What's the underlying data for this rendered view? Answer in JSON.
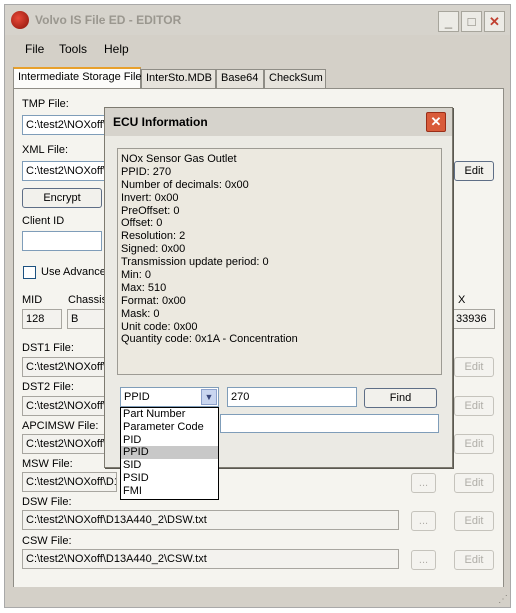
{
  "window": {
    "title": "Volvo IS File ED - EDITOR",
    "minimize_glyph": "_",
    "maximize_glyph": "□",
    "close_glyph": "✕"
  },
  "menu": [
    "File",
    "Tools",
    "Help"
  ],
  "tabs": [
    "Intermediate Storage File",
    "InterSto.MDB",
    "Base64",
    "CheckSum"
  ],
  "form": {
    "tmp_label": "TMP File:",
    "tmp_value": "C:\\test2\\NOXoff\\",
    "xml_label": "XML File:",
    "xml_value": "C:\\test2\\NOXoff\\",
    "xml_edit": "Edit",
    "encrypt_button": "Encrypt",
    "client_id_label": "Client ID",
    "client_id_value": "",
    "use_advanced_label": "Use Advance",
    "mid_label": "MID",
    "mid_value": "128",
    "chassis_label": "Chassis",
    "chassis_value": "B",
    "x_label": "X",
    "x_value": "33936",
    "dst1_label": "DST1 File:",
    "dst1_value": "C:\\test2\\NOXoff\\",
    "dst2_label": "DST2 File:",
    "dst2_value": "C:\\test2\\NOXoff\\",
    "apcimsw_label": "APCIMSW File:",
    "apcimsw_value": "C:\\test2\\NOXoff\\",
    "msw_label": "MSW File:",
    "msw_value": "C:\\test2\\NOXoff\\D13",
    "dsw_label": "DSW File:",
    "dsw_value": "C:\\test2\\NOXoff\\D13A440_2\\DSW.txt",
    "csw_label": "CSW File:",
    "csw_value": "C:\\test2\\NOXoff\\D13A440_2\\CSW.txt",
    "browse": "...",
    "edit": "Edit"
  },
  "dialog": {
    "title": "ECU Information",
    "close_glyph": "✕",
    "info_lines": [
      "NOx Sensor Gas Outlet",
      "PPID: 270",
      "Number of decimals: 0x00",
      "Invert: 0x00",
      "PreOffset: 0",
      "Offset: 0",
      "Resolution: 2",
      "Signed: 0x00",
      "Transmission update period: 0",
      "Min: 0",
      "Max: 510",
      "Format: 0x00",
      "Mask: 0",
      "Unit code: 0x00",
      "Quantity code: 0x1A - Concentration"
    ],
    "combo_value": "PPID",
    "combo_arrow": "▼",
    "search_value": "270",
    "find_button": "Find",
    "result_value": "",
    "dropdown_options": [
      "Part Number",
      "Parameter Code",
      "PID",
      "PPID",
      "SID",
      "PSID",
      "FMI"
    ],
    "dropdown_selected": "PPID"
  },
  "statusbar": {
    "grip": "⋰"
  }
}
